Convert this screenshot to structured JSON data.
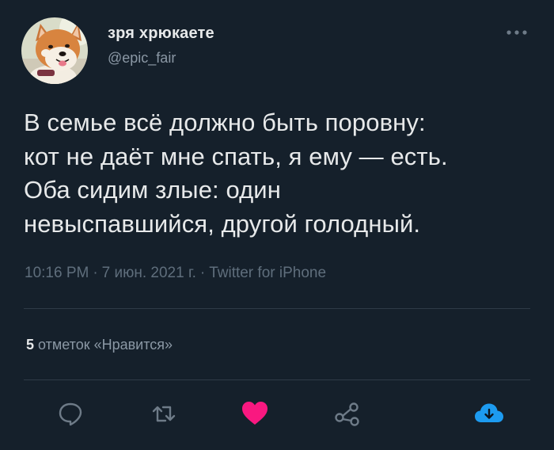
{
  "author": {
    "name": "зря хрюкаете",
    "handle": "@epic_fair"
  },
  "tweet": {
    "text": "В семье всё должно быть поровну:\nкот не даёт мне спать, я ему — есть.\nОба сидим злые: один\nневыспавшийся, другой голодный."
  },
  "meta": {
    "time": "10:16 PM",
    "date": "7 июн. 2021 г.",
    "separator": "·",
    "source": "Twitter for iPhone"
  },
  "likes": {
    "count": "5",
    "label": "отметок «Нравится»"
  },
  "actions": [
    {
      "icon": "reply-icon"
    },
    {
      "icon": "retweet-icon"
    },
    {
      "icon": "like-icon",
      "active": true
    },
    {
      "icon": "share-icon"
    },
    {
      "icon": "download-icon"
    }
  ],
  "colors": {
    "background": "#15202b",
    "text": "#e7e9ea",
    "secondary": "#8b98a5",
    "like": "#f91880",
    "accent": "#1d9bf0"
  }
}
